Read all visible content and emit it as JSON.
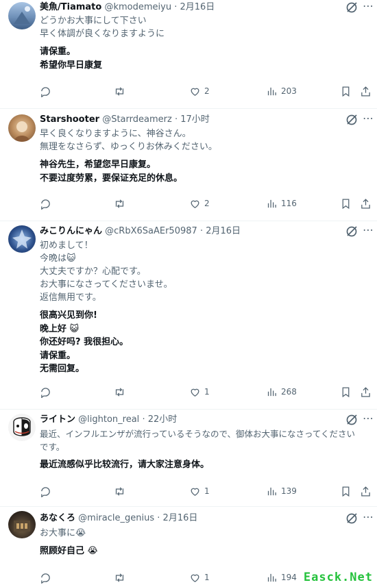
{
  "tweets": [
    {
      "name": "美魚/Tiamato",
      "handle": "@kmodemeiyu",
      "time": "2月16日",
      "original": [
        "どうかお大事にして下さい",
        "早く体調が良くなりますように"
      ],
      "translation": [
        "请保重。",
        "希望你早日康复"
      ],
      "stats": {
        "replies": "",
        "retweets": "",
        "likes": "2",
        "views": "203"
      },
      "avatar_color": "#6f90b8"
    },
    {
      "name": "Starshooter",
      "handle": "@Starrdeamerz",
      "time": "17小时",
      "original": [
        "早く良くなりますように、神谷さん。",
        "無理をなさらず、ゆっくりお休みください。"
      ],
      "translation": [
        "神谷先生，希望您早日康复。",
        "不要过度劳累，要保证充足的休息。"
      ],
      "stats": {
        "replies": "",
        "retweets": "",
        "likes": "2",
        "views": "116"
      },
      "avatar_color": "#b98a5c"
    },
    {
      "name": "みこりんにゃん",
      "handle": "@cRbX6SaAEr50987",
      "time": "2月16日",
      "original": [
        "初めまして！",
        "今晩は😺",
        "大丈夫ですか？心配です。",
        "お大事になさってくださいませ。",
        "返信無用です。"
      ],
      "translation": [
        "很高兴见到你!",
        "晚上好 😺",
        "你还好吗? 我很担心。",
        "请保重。",
        "无需回复。"
      ],
      "stats": {
        "replies": "",
        "retweets": "",
        "likes": "1",
        "views": "268"
      },
      "avatar_color": "#2c4f8a"
    },
    {
      "name": "ライトン",
      "handle": "@lighton_real",
      "time": "22小时",
      "original": [
        "最近、インフルエンザが流行っているそうなので、御体お大事になさってください",
        "です。"
      ],
      "translation": [
        "最近流感似乎比较流行，请大家注意身体。"
      ],
      "stats": {
        "replies": "",
        "retweets": "",
        "likes": "1",
        "views": "139"
      },
      "avatar_color": "#ffffff"
    },
    {
      "name": "あなくろ",
      "handle": "@miracle_genius",
      "time": "2月16日",
      "original": [
        "お大事に😭"
      ],
      "translation": [
        "照顾好自己 😭"
      ],
      "stats": {
        "replies": "",
        "retweets": "",
        "likes": "1",
        "views": "194"
      },
      "avatar_color": "#3b3026"
    }
  ],
  "watermark": "Easck.Net",
  "separator": "·",
  "more_glyph": "⋯",
  "colors": {
    "text": "#0f1419",
    "muted": "#536471",
    "border": "#eff3f4",
    "watermark": "#25c23c"
  }
}
